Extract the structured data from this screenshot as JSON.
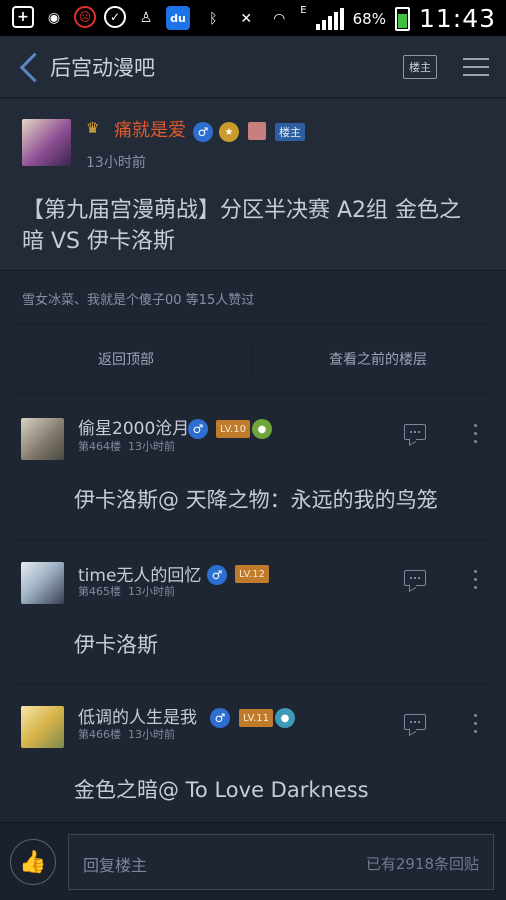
{
  "status_bar": {
    "battery_pct": "68%",
    "time": "11:43",
    "network": "E"
  },
  "header": {
    "title": "后宫动漫吧",
    "louzhu_button": "楼主"
  },
  "post": {
    "author": "痛就是爱",
    "tag": "楼主",
    "time": "13小时前",
    "title": "【第九届宫漫萌战】分区半决赛 A2组 金色之暗 VS 伊卡洛斯"
  },
  "likes_text": "雪女冰菜、我就是个傻子00 等15人赞过",
  "nav": {
    "back_to_top": "返回顶部",
    "view_previous": "查看之前的楼层"
  },
  "floors": [
    {
      "name": "偷星2000沧月",
      "level": "LV.10",
      "floor": "第464楼",
      "time": "13小时前",
      "content": "伊卡洛斯@ 天降之物：永远的我的鸟笼"
    },
    {
      "name": "time无人的回忆",
      "level": "LV.12",
      "floor": "第465楼",
      "time": "13小时前",
      "content": "伊卡洛斯"
    },
    {
      "name": "低调的人生是我",
      "level": "LV.11",
      "floor": "第466楼",
      "time": "13小时前",
      "content": "金色之暗@ To Love Darkness"
    }
  ],
  "bottom_bar": {
    "reply_placeholder": "回复楼主",
    "reply_count": "已有2918条回贴"
  },
  "colors": {
    "background": "#1f2633",
    "author_highlight": "#e05a2c",
    "level_badge": "#c07a2c",
    "gender_badge": "#2c6fd0"
  }
}
